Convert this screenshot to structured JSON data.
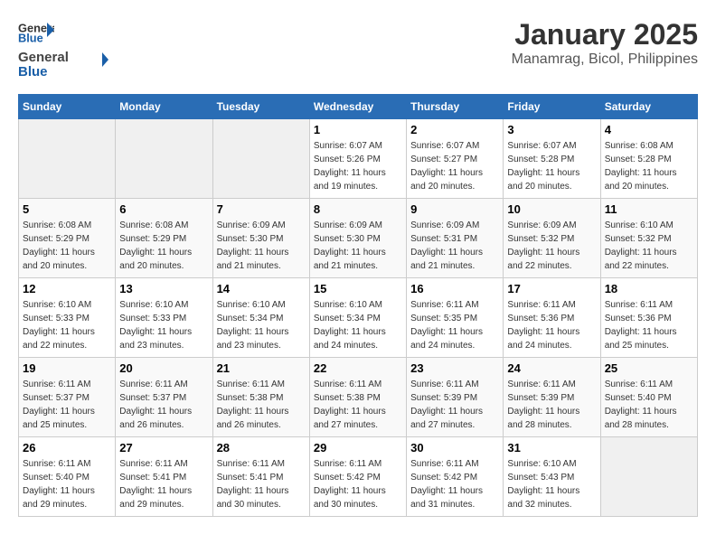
{
  "logo": {
    "general": "General",
    "blue": "Blue"
  },
  "title": "January 2025",
  "subtitle": "Manamrag, Bicol, Philippines",
  "headers": [
    "Sunday",
    "Monday",
    "Tuesday",
    "Wednesday",
    "Thursday",
    "Friday",
    "Saturday"
  ],
  "weeks": [
    [
      {
        "day": "",
        "info": ""
      },
      {
        "day": "",
        "info": ""
      },
      {
        "day": "",
        "info": ""
      },
      {
        "day": "1",
        "info": "Sunrise: 6:07 AM\nSunset: 5:26 PM\nDaylight: 11 hours\nand 19 minutes."
      },
      {
        "day": "2",
        "info": "Sunrise: 6:07 AM\nSunset: 5:27 PM\nDaylight: 11 hours\nand 20 minutes."
      },
      {
        "day": "3",
        "info": "Sunrise: 6:07 AM\nSunset: 5:28 PM\nDaylight: 11 hours\nand 20 minutes."
      },
      {
        "day": "4",
        "info": "Sunrise: 6:08 AM\nSunset: 5:28 PM\nDaylight: 11 hours\nand 20 minutes."
      }
    ],
    [
      {
        "day": "5",
        "info": "Sunrise: 6:08 AM\nSunset: 5:29 PM\nDaylight: 11 hours\nand 20 minutes."
      },
      {
        "day": "6",
        "info": "Sunrise: 6:08 AM\nSunset: 5:29 PM\nDaylight: 11 hours\nand 20 minutes."
      },
      {
        "day": "7",
        "info": "Sunrise: 6:09 AM\nSunset: 5:30 PM\nDaylight: 11 hours\nand 21 minutes."
      },
      {
        "day": "8",
        "info": "Sunrise: 6:09 AM\nSunset: 5:30 PM\nDaylight: 11 hours\nand 21 minutes."
      },
      {
        "day": "9",
        "info": "Sunrise: 6:09 AM\nSunset: 5:31 PM\nDaylight: 11 hours\nand 21 minutes."
      },
      {
        "day": "10",
        "info": "Sunrise: 6:09 AM\nSunset: 5:32 PM\nDaylight: 11 hours\nand 22 minutes."
      },
      {
        "day": "11",
        "info": "Sunrise: 6:10 AM\nSunset: 5:32 PM\nDaylight: 11 hours\nand 22 minutes."
      }
    ],
    [
      {
        "day": "12",
        "info": "Sunrise: 6:10 AM\nSunset: 5:33 PM\nDaylight: 11 hours\nand 22 minutes."
      },
      {
        "day": "13",
        "info": "Sunrise: 6:10 AM\nSunset: 5:33 PM\nDaylight: 11 hours\nand 23 minutes."
      },
      {
        "day": "14",
        "info": "Sunrise: 6:10 AM\nSunset: 5:34 PM\nDaylight: 11 hours\nand 23 minutes."
      },
      {
        "day": "15",
        "info": "Sunrise: 6:10 AM\nSunset: 5:34 PM\nDaylight: 11 hours\nand 24 minutes."
      },
      {
        "day": "16",
        "info": "Sunrise: 6:11 AM\nSunset: 5:35 PM\nDaylight: 11 hours\nand 24 minutes."
      },
      {
        "day": "17",
        "info": "Sunrise: 6:11 AM\nSunset: 5:36 PM\nDaylight: 11 hours\nand 24 minutes."
      },
      {
        "day": "18",
        "info": "Sunrise: 6:11 AM\nSunset: 5:36 PM\nDaylight: 11 hours\nand 25 minutes."
      }
    ],
    [
      {
        "day": "19",
        "info": "Sunrise: 6:11 AM\nSunset: 5:37 PM\nDaylight: 11 hours\nand 25 minutes."
      },
      {
        "day": "20",
        "info": "Sunrise: 6:11 AM\nSunset: 5:37 PM\nDaylight: 11 hours\nand 26 minutes."
      },
      {
        "day": "21",
        "info": "Sunrise: 6:11 AM\nSunset: 5:38 PM\nDaylight: 11 hours\nand 26 minutes."
      },
      {
        "day": "22",
        "info": "Sunrise: 6:11 AM\nSunset: 5:38 PM\nDaylight: 11 hours\nand 27 minutes."
      },
      {
        "day": "23",
        "info": "Sunrise: 6:11 AM\nSunset: 5:39 PM\nDaylight: 11 hours\nand 27 minutes."
      },
      {
        "day": "24",
        "info": "Sunrise: 6:11 AM\nSunset: 5:39 PM\nDaylight: 11 hours\nand 28 minutes."
      },
      {
        "day": "25",
        "info": "Sunrise: 6:11 AM\nSunset: 5:40 PM\nDaylight: 11 hours\nand 28 minutes."
      }
    ],
    [
      {
        "day": "26",
        "info": "Sunrise: 6:11 AM\nSunset: 5:40 PM\nDaylight: 11 hours\nand 29 minutes."
      },
      {
        "day": "27",
        "info": "Sunrise: 6:11 AM\nSunset: 5:41 PM\nDaylight: 11 hours\nand 29 minutes."
      },
      {
        "day": "28",
        "info": "Sunrise: 6:11 AM\nSunset: 5:41 PM\nDaylight: 11 hours\nand 30 minutes."
      },
      {
        "day": "29",
        "info": "Sunrise: 6:11 AM\nSunset: 5:42 PM\nDaylight: 11 hours\nand 30 minutes."
      },
      {
        "day": "30",
        "info": "Sunrise: 6:11 AM\nSunset: 5:42 PM\nDaylight: 11 hours\nand 31 minutes."
      },
      {
        "day": "31",
        "info": "Sunrise: 6:10 AM\nSunset: 5:43 PM\nDaylight: 11 hours\nand 32 minutes."
      },
      {
        "day": "",
        "info": ""
      }
    ]
  ]
}
